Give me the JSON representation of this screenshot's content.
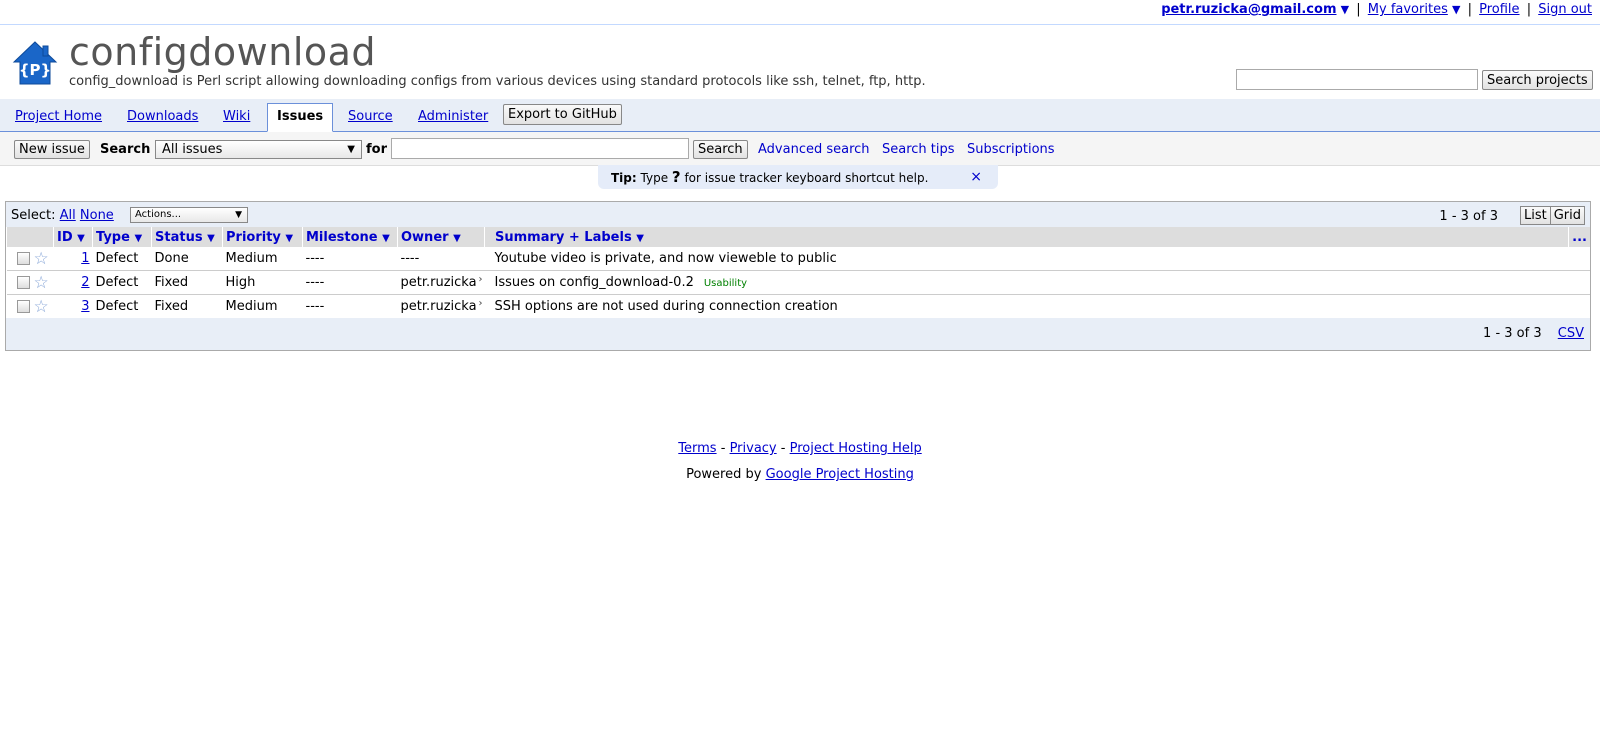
{
  "account": {
    "email": "petr.ruzicka@gmail.com",
    "favorites": "My favorites",
    "profile": "Profile",
    "signout": "Sign out",
    "separator": "|",
    "caret": "▼"
  },
  "project": {
    "name": "configdownload",
    "summary": "config_download is Perl script allowing downloading configs from various devices using standard protocols like ssh, telnet, ftp, http.",
    "logo_letter": "{P}",
    "search_placeholder": "",
    "search_button": "Search projects"
  },
  "tabs": [
    {
      "label": "Project Home"
    },
    {
      "label": "Downloads"
    },
    {
      "label": "Wiki"
    },
    {
      "label": "Issues",
      "active": true
    },
    {
      "label": "Source"
    },
    {
      "label": "Administer"
    }
  ],
  "export_button": "Export to GitHub",
  "issues_toolbar": {
    "new_issue": "New issue",
    "search_label": "Search",
    "search_scope": "All issues",
    "for_label": "for",
    "query_value": "",
    "search_button": "Search",
    "advanced_search": "Advanced search",
    "search_tips": "Search tips",
    "subscriptions": "Subscriptions"
  },
  "tip": {
    "label": "Tip:",
    "before": "Type",
    "key": "?",
    "after": "for issue tracker keyboard shortcut help.",
    "close": "×"
  },
  "results": {
    "select_label": "Select:",
    "select_all": "All",
    "select_none": "None",
    "actions": "Actions...",
    "pagination": "1 - 3 of 3",
    "view_list": "List",
    "view_grid": "Grid",
    "csv": "CSV",
    "more_columns": "...",
    "columns": [
      "ID",
      "Type",
      "Status",
      "Priority",
      "Milestone",
      "Owner",
      "Summary + Labels"
    ],
    "rows": [
      {
        "id": "1",
        "type": "Defect",
        "status": "Done",
        "priority": "Medium",
        "milestone": "----",
        "owner": "----",
        "summary": "Youtube video is private, and now vieweble to public",
        "label": ""
      },
      {
        "id": "2",
        "type": "Defect",
        "status": "Fixed",
        "priority": "High",
        "milestone": "----",
        "owner": "petr.ruzicka",
        "summary": "Issues on config_download-0.2",
        "label": "Usability"
      },
      {
        "id": "3",
        "type": "Defect",
        "status": "Fixed",
        "priority": "Medium",
        "milestone": "----",
        "owner": "petr.ruzicka",
        "summary": "SSH options are not used during connection creation",
        "label": ""
      }
    ]
  },
  "footer": {
    "terms": "Terms",
    "privacy": "Privacy",
    "help": "Project Hosting Help",
    "dash": "-",
    "powered_by": "Powered by",
    "powered_link": "Google Project Hosting"
  },
  "colors": {
    "link": "#0000cc",
    "tab_bar": "#e8eef7",
    "tab_border": "#6b90da",
    "logo_blue": "#1a66c8",
    "label_green": "#008000"
  }
}
